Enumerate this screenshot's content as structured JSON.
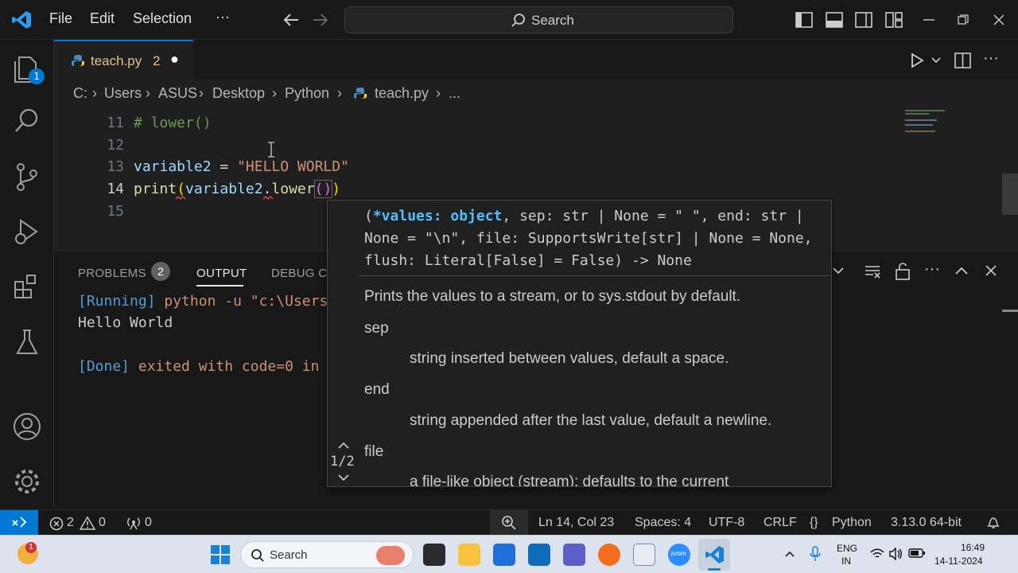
{
  "menu": {
    "file": "File",
    "edit": "Edit",
    "selection": "Selection",
    "more": "···"
  },
  "search": {
    "label": "Search"
  },
  "activity": {
    "explorer_badge": "1"
  },
  "tab": {
    "filename": "teach.py",
    "problem_count": "2",
    "dirty": "●"
  },
  "breadcrumb": {
    "items": [
      "C:",
      "Users",
      "ASUS",
      "Desktop",
      "Python",
      "teach.py",
      "..."
    ]
  },
  "editor": {
    "lines": [
      {
        "num": "11",
        "code": "# lower()"
      },
      {
        "num": "12",
        "code": ""
      },
      {
        "num": "13",
        "var": "variable2",
        "op": " = ",
        "str": "\"HELLO WORLD\""
      },
      {
        "num": "14",
        "fn": "print",
        "p1": "(",
        "arg": "variable2",
        "dot": ".",
        "method": "lower",
        "p2": "()",
        "p3": ")"
      },
      {
        "num": "15",
        "code": ""
      }
    ]
  },
  "panel": {
    "tabs": {
      "problems": "PROBLEMS",
      "problems_count": "2",
      "output": "OUTPUT",
      "debug": "DEBUG CO"
    },
    "output": {
      "running_tag": "[Running]",
      "running_cmd": " python -u \"c:\\Users",
      "hello": "Hello World",
      "done_tag": "[Done]",
      "done_text": " exited with code=0 in"
    }
  },
  "hover": {
    "sig_open": "(",
    "sig_param": "*values: object",
    "sig_line1_rest": ", sep: str | None = \" \", end: str |",
    "sig_line2": "None = \"\\n\", file: SupportsWrite[str] | None = None,",
    "sig_line3": "flush: Literal[False] = False) -> None",
    "description": "Prints the values to a stream, or to sys.stdout by default.",
    "sep_name": "sep",
    "sep_desc": "string inserted between values, default a space.",
    "end_name": "end",
    "end_desc": "string appended after the last value, default a newline.",
    "file_name": "file",
    "file_desc": "a file-like object (stream); defaults to the current",
    "counter": "1/2"
  },
  "status": {
    "errors": "2",
    "warnings": "0",
    "ports": "0",
    "position": "Ln 14, Col 23",
    "spaces": "Spaces: 4",
    "encoding": "UTF-8",
    "eol": "CRLF",
    "language": "Python",
    "interpreter": "3.13.0 64-bit"
  },
  "taskbar": {
    "search_label": "Search",
    "notif_badge": "1",
    "lang1": "ENG",
    "lang2": "IN",
    "time": "16:49",
    "date": "14-11-2024",
    "zoom_label": "zoom"
  },
  "colors": {
    "accent": "#0078d4",
    "remote": "#0078d4",
    "string": "#ce9178",
    "keyword": "#569cd6",
    "func": "#dcdcaa",
    "var": "#9cdcfe",
    "comment": "#6a9955"
  }
}
